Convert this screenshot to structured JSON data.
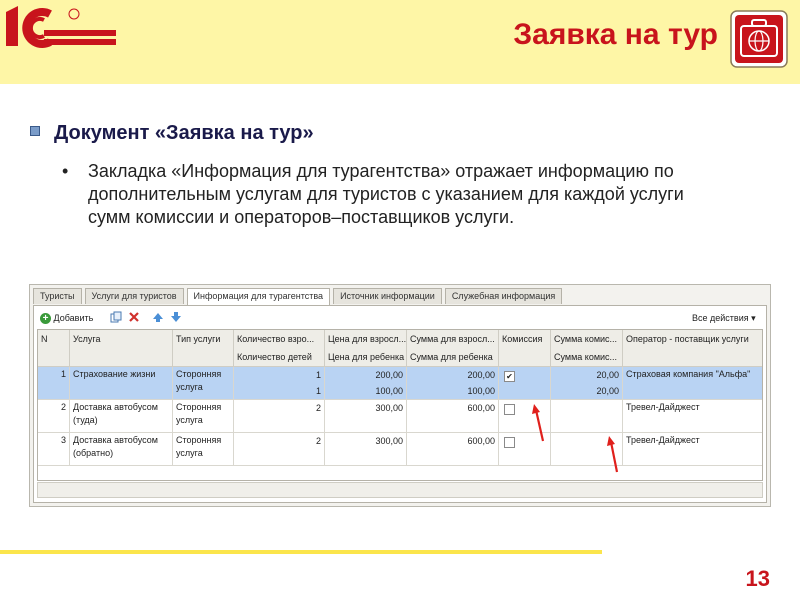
{
  "slide": {
    "title": "Заявка на тур",
    "page_number": "13"
  },
  "content": {
    "bullet_main": "Документ «Заявка на тур»",
    "bullet_sub": "Закладка «Информация для турагентства» отражает информацию по дополнительным услугам для туристов с указанием для каждой услуги сумм комиссии и операторов–поставщиков услуги."
  },
  "window": {
    "tabs": [
      {
        "label": "Туристы"
      },
      {
        "label": "Услуги для туристов"
      },
      {
        "label": "Информация для турагентства"
      },
      {
        "label": "Источник информации"
      },
      {
        "label": "Служебная информация"
      }
    ],
    "toolbar": {
      "add_label": "Добавить",
      "all_actions_label": "Все действия ▾"
    },
    "columns": {
      "n": "N",
      "service": "Услуга",
      "service_type": "Тип услуги",
      "adults_qty": "Количество взро...",
      "children_qty": "Количество детей",
      "adult_price": "Цена для взросл...",
      "child_price": "Цена для ребенка",
      "adult_sum": "Сумма для взросл...",
      "child_sum": "Сумма для ребенка",
      "commission": "Комиссия",
      "commission_sum1": "Сумма комис...",
      "commission_sum2": "Сумма комис...",
      "operator": "Оператор - поставщик услуги"
    },
    "rows": [
      {
        "n": "1",
        "service": "Страхование жизни",
        "type": "Сторонняя услуга",
        "adults": "1",
        "children": "1",
        "price_adult": "200,00",
        "price_child": "100,00",
        "sum_adult": "200,00",
        "sum_child": "100,00",
        "commission": "✔",
        "comm_sum1": "20,00",
        "comm_sum2": "20,00",
        "operator": "Страховая компания \"Альфа\""
      },
      {
        "n": "2",
        "service": "Доставка автобусом (туда)",
        "type": "Сторонняя услуга",
        "adults": "2",
        "children": "",
        "price_adult": "300,00",
        "price_child": "",
        "sum_adult": "600,00",
        "sum_child": "",
        "commission": "",
        "comm_sum1": "",
        "comm_sum2": "",
        "operator": "Тревел-Дайджест"
      },
      {
        "n": "3",
        "service": "Доставка автобусом (обратно)",
        "type": "Сторонняя услуга",
        "adults": "2",
        "children": "",
        "price_adult": "300,00",
        "price_child": "",
        "sum_adult": "600,00",
        "sum_child": "",
        "commission": "",
        "comm_sum1": "",
        "comm_sum2": "",
        "operator": "Тревел-Дайджест"
      }
    ]
  },
  "colors": {
    "accent_red": "#c8141c",
    "header_bg": "#fef6a6",
    "selection": "#b9d3f3"
  }
}
